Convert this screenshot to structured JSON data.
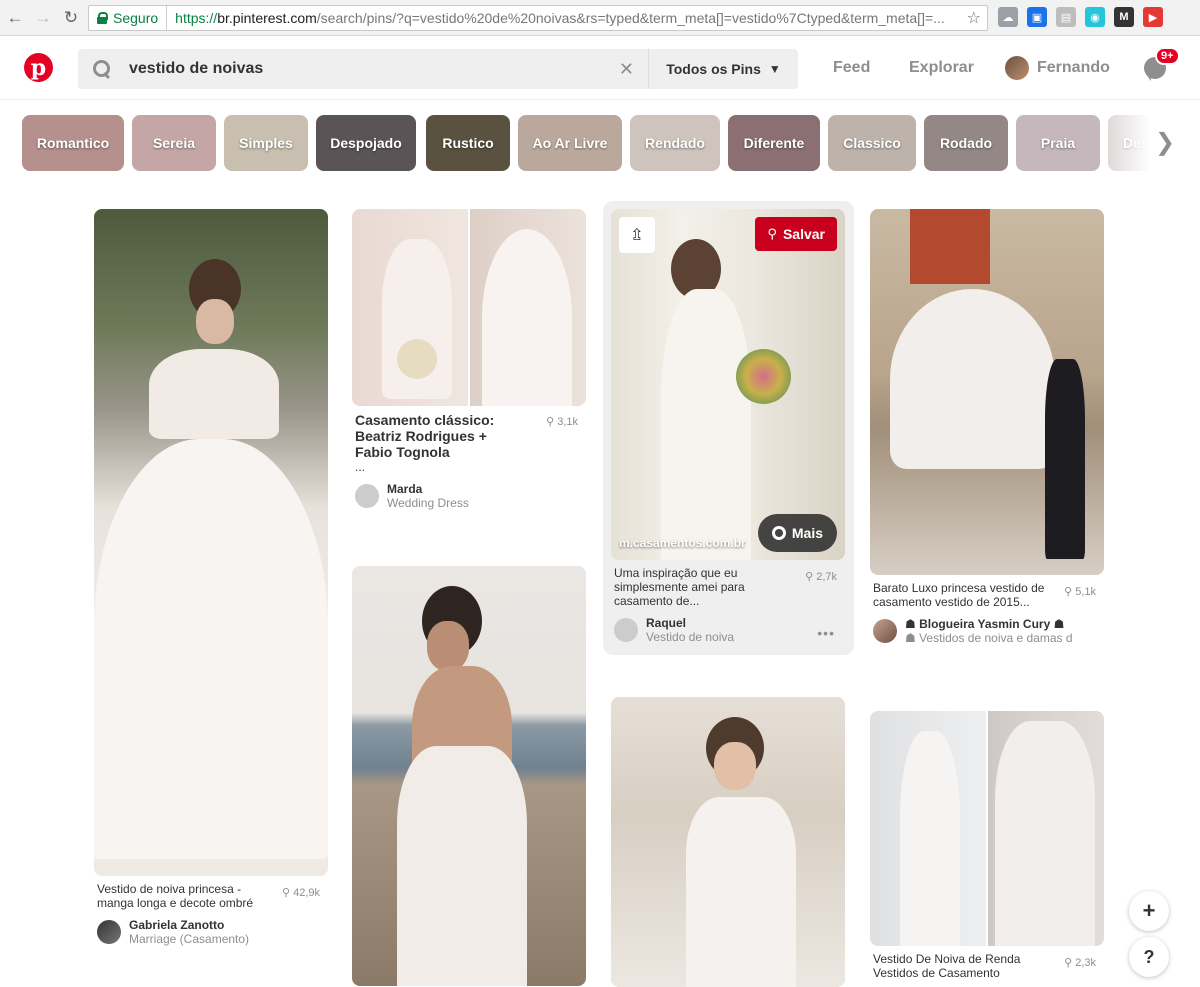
{
  "browser": {
    "secure_label": "Seguro",
    "url_proto": "https://",
    "url_host": "br.pinterest.com",
    "url_path": "/search/pins/?q=vestido%20de%20noivas&rs=typed&term_meta[]=vestido%7Ctyped&term_meta[]=...",
    "extensions": [
      {
        "name": "cloud-icon",
        "glyph": "☁",
        "color": "#9aa0a6"
      },
      {
        "name": "extension-blue-icon",
        "glyph": "▣",
        "color": "#1a73e8"
      },
      {
        "name": "extension-doc-icon",
        "glyph": "▤",
        "color": "#bdbdbd"
      },
      {
        "name": "extension-teal-icon",
        "glyph": "◉",
        "color": "#26c6da"
      },
      {
        "name": "extension-m-icon",
        "glyph": "M",
        "color": "#333333"
      },
      {
        "name": "youtube-extension-icon",
        "glyph": "▶",
        "color": "#e53935"
      }
    ]
  },
  "header": {
    "logo": "p",
    "search_query": "vestido de noivas",
    "clear": "✕",
    "scope_label": "Todos os Pins",
    "nav_feed": "Feed",
    "nav_explore": "Explorar",
    "user_name": "Fernando",
    "notification_badge": "9+"
  },
  "guides": [
    {
      "label": "Romantico",
      "color": "#b5908c"
    },
    {
      "label": "Sereia",
      "color": "#c4a6a6"
    },
    {
      "label": "Simples",
      "color": "#c9bfb0"
    },
    {
      "label": "Despojado",
      "color": "#5b5456"
    },
    {
      "label": "Rustico",
      "color": "#5a5140"
    },
    {
      "label": "Ao Ar Livre",
      "color": "#bba89c"
    },
    {
      "label": "Rendado",
      "color": "#cfc3bd"
    },
    {
      "label": "Diferente",
      "color": "#8c6f73"
    },
    {
      "label": "Classico",
      "color": "#bdb3ab"
    },
    {
      "label": "Rodado",
      "color": "#948887"
    },
    {
      "label": "Praia",
      "color": "#c5b7bb"
    },
    {
      "label": "Dest",
      "color": "#d9d2d1"
    }
  ],
  "pins": {
    "p1": {
      "caption": "Vestido de noiva princesa - manga longa e decote ombré",
      "saves": "42,9k",
      "user": "Gabriela Zanotto",
      "board": "Marriage (Casamento)"
    },
    "p2": {
      "caption": "Casamento clássico: Beatriz Rodrigues + Fabio Tognola",
      "ellipsis": "...",
      "saves": "3,1k",
      "user": "Marda",
      "board": "Wedding Dress"
    },
    "p3": {
      "caption": "Uma inspiração que eu simplesmente amei para casamento de...",
      "saves": "2,7k",
      "user": "Raquel",
      "board": "Vestido de noiva",
      "domain": "m.casamentos.com.br",
      "save_label": "Salvar",
      "more_label": "Mais"
    },
    "p4": {
      "caption": "Barato Luxo princesa vestido de casamento vestido de 2015...",
      "saves": "5,1k",
      "user": "☗ Blogueira Yasmin Cury ☗",
      "board": "☗ Vestidos de noiva e damas d"
    },
    "p5": {
      "caption": "Vestido De Noiva de Renda Vestidos de Casamento",
      "saves": "2,3k"
    }
  },
  "fab": {
    "plus": "+",
    "help": "?"
  },
  "pin_glyph": "⚲"
}
